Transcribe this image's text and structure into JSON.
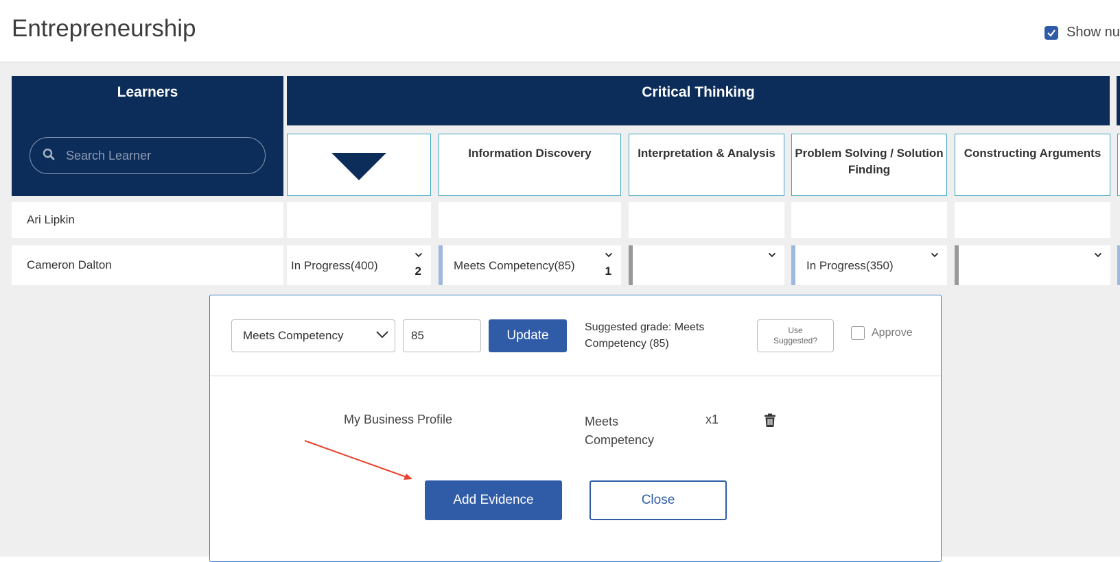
{
  "header": {
    "title": "Entrepreneurship",
    "show_numbers_label": "Show nu",
    "show_numbers_checked": true
  },
  "grid": {
    "learners_title": "Learners",
    "search_placeholder": "Search Learner",
    "group_title": "Critical Thinking",
    "columns": [
      "",
      "Information Discovery",
      "Interpretation & Analysis",
      "Problem Solving / Solution Finding",
      "Constructing Arguments"
    ],
    "rows": [
      {
        "name": "Ari Lipkin",
        "cells": [
          "",
          "",
          "",
          "",
          ""
        ]
      },
      {
        "name": "Cameron Dalton",
        "cells": [
          {
            "value": "In Progress(400)",
            "count": "2"
          },
          {
            "value": "Meets Competency(85)",
            "count": "1"
          },
          {
            "value": "",
            "count": ""
          },
          {
            "value": "In Progress(350)",
            "count": ""
          },
          {
            "value": "",
            "count": ""
          }
        ]
      }
    ]
  },
  "panel": {
    "grade_select": "Meets Competency",
    "score_value": "85",
    "update_label": "Update",
    "suggested_text": "Suggested grade: Meets Competency (85)",
    "use_suggested_line1": "Use",
    "use_suggested_line2": "Suggested?",
    "approve_label": "Approve",
    "evidence": {
      "name": "My Business Profile",
      "grade": "Meets Competency",
      "count": "x1"
    },
    "add_evidence_label": "Add Evidence",
    "close_label": "Close"
  },
  "colors": {
    "header_navy": "#0c2d5a",
    "primary_blue": "#2f5ba7",
    "bar_light_blue": "#9fb8e0",
    "bar_gray": "#999999",
    "arrow_red": "#e8432c"
  }
}
